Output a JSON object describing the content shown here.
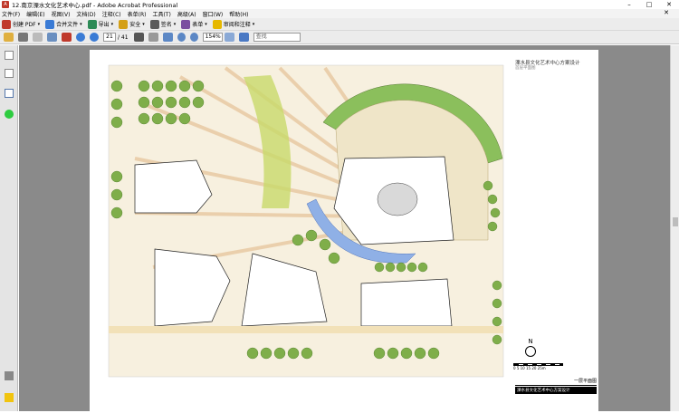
{
  "window": {
    "title": "12.南京溧水文化艺术中心.pdf - Adobe Acrobat Professional",
    "app_icon": "pdf-icon",
    "controls": [
      "–",
      "□",
      "✕"
    ]
  },
  "menu": {
    "items": [
      "文件(F)",
      "编辑(E)",
      "视图(V)",
      "文档(D)",
      "注释(C)",
      "表单(R)",
      "工具(T)",
      "高级(A)",
      "窗口(W)",
      "帮助(H)"
    ],
    "close": "✕"
  },
  "toolbar1": {
    "create_pdf": "创建 PDF",
    "merge_files": "合并文件",
    "export": "导出",
    "security": "安全",
    "sign": "签名",
    "forms": "表单",
    "review": "审阅和注释"
  },
  "toolbar2": {
    "page_current": "21",
    "page_total": "/ 41",
    "zoom": "154%",
    "find_placeholder": "查找"
  },
  "document": {
    "drawing_title": "溧水县文化艺术中心方案设计",
    "drawing_subtitle": "首层平面图",
    "north_label": "N",
    "scale_text": "0 5 10 15 20 25m",
    "sheet_label": "一层平面图",
    "sheet_project": "溧水县文化艺术中心方案设计"
  },
  "colors": {
    "titlebar_bg": "#ffffff",
    "toolbar_bg": "#ececec",
    "doc_bg": "#8a8a8a",
    "pdf_red": "#c0392b"
  }
}
